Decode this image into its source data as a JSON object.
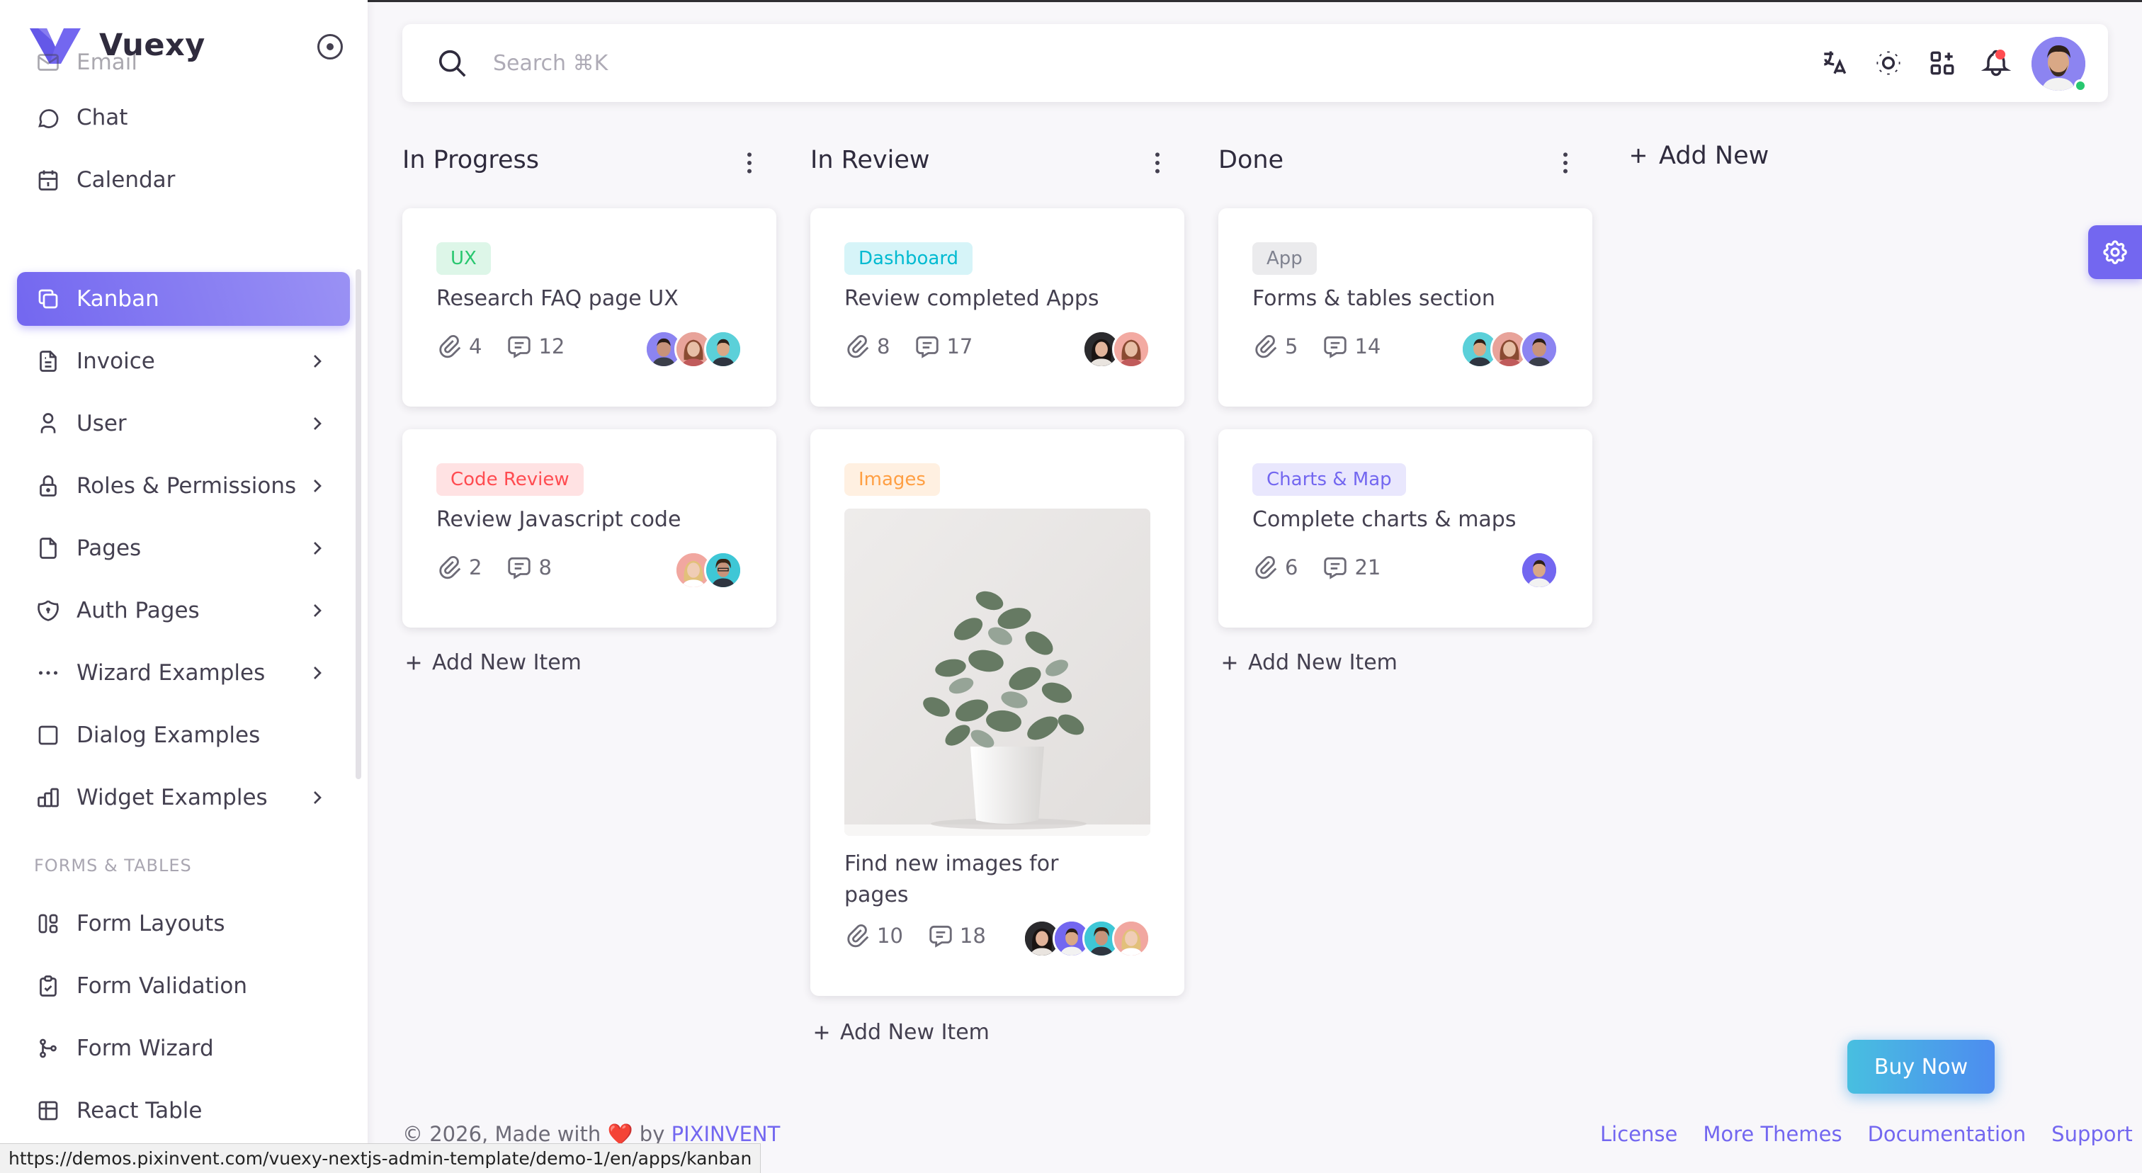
{
  "app": {
    "name": "Vuexy"
  },
  "sidebar": {
    "items": [
      {
        "label": "Email",
        "icon": "mail-icon",
        "faded": true
      },
      {
        "label": "Chat",
        "icon": "chat-icon"
      },
      {
        "label": "Calendar",
        "icon": "calendar-icon"
      },
      {
        "label": "Kanban",
        "icon": "kanban-icon",
        "active": true
      },
      {
        "label": "Invoice",
        "icon": "invoice-icon",
        "submenu": true
      },
      {
        "label": "User",
        "icon": "user-icon",
        "submenu": true
      },
      {
        "label": "Roles & Permissions",
        "icon": "lock-icon",
        "submenu": true
      },
      {
        "label": "Pages",
        "icon": "file-icon",
        "submenu": true
      },
      {
        "label": "Auth Pages",
        "icon": "shield-icon",
        "submenu": true
      },
      {
        "label": "Wizard Examples",
        "icon": "dots-icon",
        "submenu": true
      },
      {
        "label": "Dialog Examples",
        "icon": "square-icon"
      },
      {
        "label": "Widget Examples",
        "icon": "chart-bar-icon",
        "submenu": true
      }
    ],
    "section_forms": "FORMS & TABLES",
    "form_items": [
      {
        "label": "Form Layouts",
        "icon": "layout-icon"
      },
      {
        "label": "Form Validation",
        "icon": "clipboard-check-icon"
      },
      {
        "label": "Form Wizard",
        "icon": "git-branch-icon"
      },
      {
        "label": "React Table",
        "icon": "table-icon"
      }
    ]
  },
  "navbar": {
    "search_placeholder": "Search ⌘K",
    "icons": [
      "translate-icon",
      "sun-icon",
      "apps-icon",
      "bell-icon"
    ]
  },
  "kanban": {
    "columns": [
      {
        "title": "In Progress",
        "cards": [
          {
            "tag": "UX",
            "tag_color": "green",
            "title": "Research FAQ page UX",
            "attachments": "4",
            "comments": "12",
            "avatars": [
              "purple",
              "pink",
              "cyan"
            ]
          },
          {
            "tag": "Code Review",
            "tag_color": "red",
            "title": "Review Javascript code",
            "attachments": "2",
            "comments": "8",
            "avatars": [
              "pink",
              "cyan"
            ]
          }
        ],
        "add_label": "Add New Item"
      },
      {
        "title": "In Review",
        "cards": [
          {
            "tag": "Dashboard",
            "tag_color": "cyan",
            "title": "Review completed Apps",
            "attachments": "8",
            "comments": "17",
            "avatars": [
              "dark",
              "pink"
            ]
          },
          {
            "tag": "Images",
            "tag_color": "orange",
            "title": "Find new images for pages",
            "title_line1": "Find new images for",
            "title_line2": "pages",
            "attachments": "10",
            "comments": "18",
            "avatars": [
              "dark",
              "purple",
              "teal",
              "pink"
            ],
            "image": "plant-photo"
          }
        ],
        "add_label": "Add New Item"
      },
      {
        "title": "Done",
        "cards": [
          {
            "tag": "App",
            "tag_color": "gray",
            "title": "Forms & tables section",
            "attachments": "5",
            "comments": "14",
            "avatars": [
              "cyan",
              "pink",
              "purple"
            ]
          },
          {
            "tag": "Charts & Map",
            "tag_color": "purple",
            "title": "Complete charts & maps",
            "attachments": "6",
            "comments": "21",
            "avatars": [
              "purple"
            ]
          }
        ],
        "add_label": "Add New Item"
      }
    ],
    "add_new_label": "Add New"
  },
  "buy_now": "Buy Now",
  "footer": {
    "copyright_prefix": "© 2026, Made with ",
    "heart": "❤️",
    "by": " by ",
    "brand": "PIXINVENT",
    "links": [
      "License",
      "More Themes",
      "Documentation",
      "Support"
    ]
  },
  "status_url": "https://demos.pixinvent.com/vuexy-nextjs-admin-template/demo-1/en/apps/kanban",
  "colors": {
    "primary": "#7367f0",
    "chip_green_bg": "#ddf6e8",
    "chip_green_fg": "#28c76f",
    "chip_red_bg": "#ffe2e3",
    "chip_red_fg": "#ff4c51",
    "chip_cyan_bg": "#d6f4f8",
    "chip_cyan_fg": "#00bad1",
    "chip_orange_bg": "#fff0e1",
    "chip_orange_fg": "#ff9f43",
    "chip_gray_bg": "#ebebed",
    "chip_gray_fg": "#808390",
    "chip_purple_bg": "#e9e7fd",
    "chip_purple_fg": "#7367f0"
  }
}
